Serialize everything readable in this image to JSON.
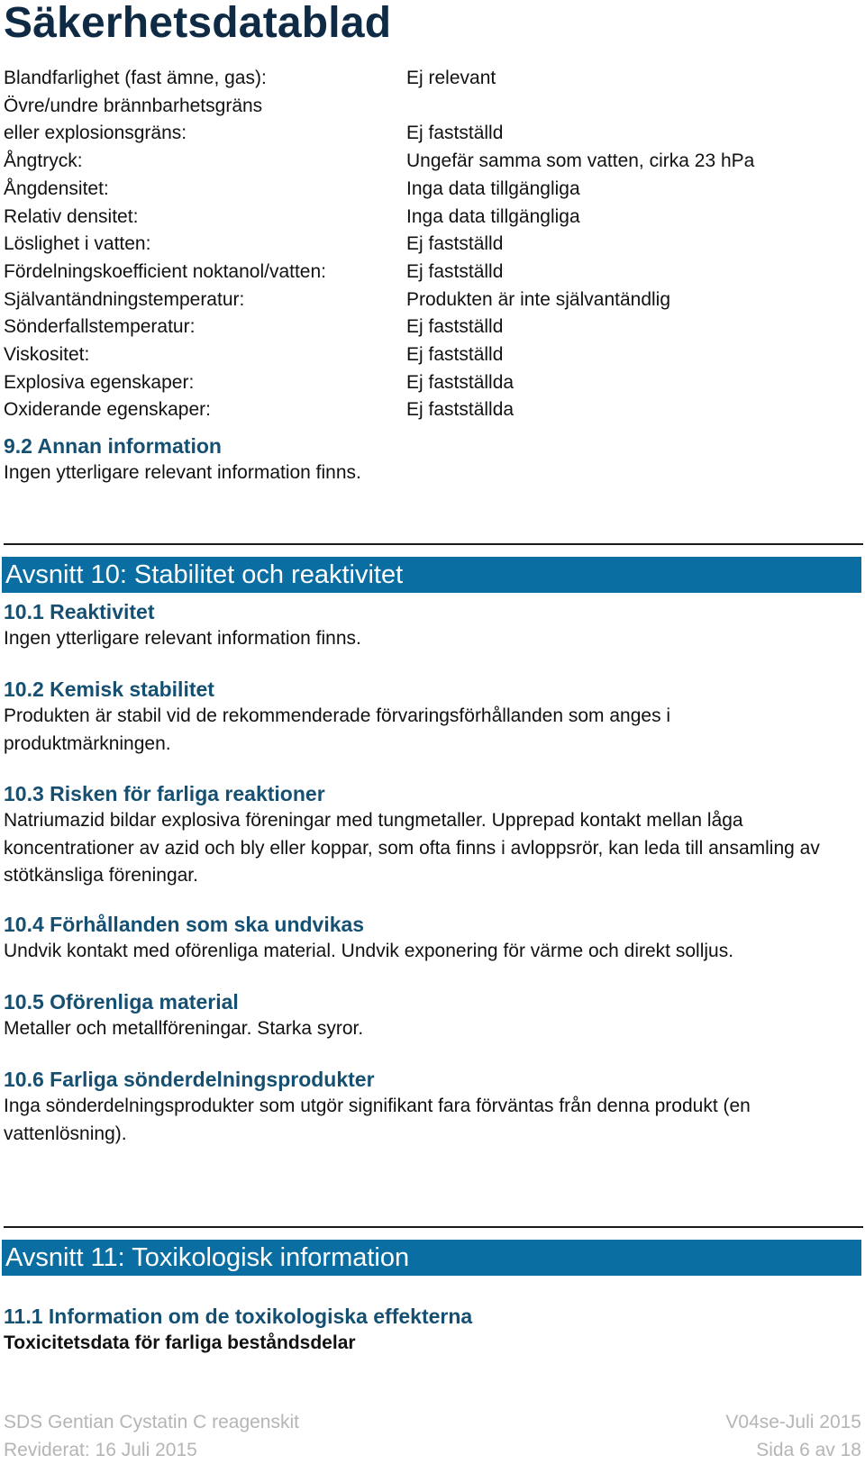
{
  "document": {
    "title": "Säkerhetsdatablad"
  },
  "properties": [
    {
      "label": "Blandfarlighet (fast ämne, gas):",
      "value": "Ej relevant"
    },
    {
      "label": "Övre/undre brännbarhetsgräns\neller explosionsgräns:",
      "value": "Ej fastställd"
    },
    {
      "label": "Ångtryck:",
      "value": "Ungefär samma som vatten, cirka 23 hPa"
    },
    {
      "label": "Ångdensitet:",
      "value": "Inga data tillgängliga"
    },
    {
      "label": "Relativ densitet:",
      "value": "Inga data tillgängliga"
    },
    {
      "label": "Löslighet i vatten:",
      "value": "Ej fastställd"
    },
    {
      "label": "Fördelningskoefficient noktanol/vatten:",
      "value": "Ej fastställd"
    },
    {
      "label": "Självantändningstemperatur:",
      "value": "Produkten är inte självantändlig"
    },
    {
      "label": "Sönderfallstemperatur:",
      "value": "Ej fastställd"
    },
    {
      "label": "Viskositet:",
      "value": "Ej fastställd"
    },
    {
      "label": "Explosiva egenskaper:",
      "value": "Ej fastställda"
    },
    {
      "label": "Oxiderande egenskaper:",
      "value": "Ej fastställda"
    }
  ],
  "section9_2": {
    "heading": "9.2 Annan information",
    "text": "Ingen ytterligare relevant information finns."
  },
  "section10": {
    "banner": "Avsnitt 10: Stabilitet och reaktivitet",
    "subsections": [
      {
        "heading": "10.1 Reaktivitet",
        "text": "Ingen ytterligare relevant information finns."
      },
      {
        "heading": "10.2 Kemisk stabilitet",
        "text": "Produkten är stabil vid de rekommenderade förvaringsförhållanden som anges i produktmärkningen."
      },
      {
        "heading": "10.3 Risken för farliga reaktioner",
        "text": "Natriumazid bildar explosiva föreningar med tungmetaller. Upprepad kontakt mellan låga koncentrationer av azid och bly eller koppar, som ofta finns i avloppsrör, kan leda till ansamling av stötkänsliga föreningar."
      },
      {
        "heading": "10.4 Förhållanden som ska undvikas",
        "text": "Undvik kontakt med oförenliga material. Undvik exponering för värme och direkt solljus."
      },
      {
        "heading": "10.5 Oförenliga material",
        "text": "Metaller och metallföreningar. Starka syror."
      },
      {
        "heading": "10.6 Farliga sönderdelningsprodukter",
        "text": "Inga sönderdelningsprodukter som utgör signifikant fara förväntas från denna produkt (en vattenlösning)."
      }
    ]
  },
  "section11": {
    "banner": "Avsnitt 11: Toxikologisk information",
    "subheading": "11.1 Information om de toxikologiska effekterna",
    "bold_line": "Toxicitetsdata för farliga beståndsdelar"
  },
  "footer": {
    "product": "SDS Gentian Cystatin C reagenskit",
    "version": "V04se-Juli 2015",
    "revised": "Reviderat: 16 Juli 2015",
    "page": "Sida 6 av 18"
  },
  "colors": {
    "title": "#0f2a44",
    "subheading": "#155072",
    "banner_bg": "#0a6ea3",
    "footer_text": "#b5b5b5"
  }
}
